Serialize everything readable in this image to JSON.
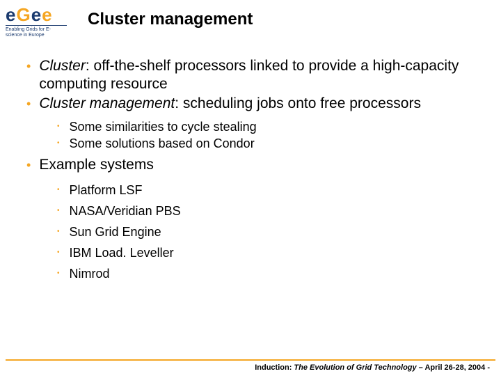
{
  "logo": {
    "e1": "e",
    "g1": "G",
    "e2": "e",
    "e3": "e",
    "sub": "Enabling Grids for E-science in Europe"
  },
  "title": "Cluster management",
  "bullets": {
    "b1_term": "Cluster",
    "b1_rest": ": off-the-shelf processors linked to provide a high-capacity computing resource",
    "b2_term": "Cluster management",
    "b2_rest": ": scheduling jobs onto free processors",
    "sub1": "Some similarities to cycle stealing",
    "sub2": "Some solutions based on Condor",
    "b3": "Example systems",
    "ex1": "Platform LSF",
    "ex2": "NASA/Veridian PBS",
    "ex3": "Sun Grid Engine",
    "ex4": "IBM Load. Leveller",
    "ex5": "Nimrod"
  },
  "footer": {
    "lead": "Induction: ",
    "title": "The Evolution of Grid Technology",
    "date": "  – April 26-28, 2004  -"
  }
}
